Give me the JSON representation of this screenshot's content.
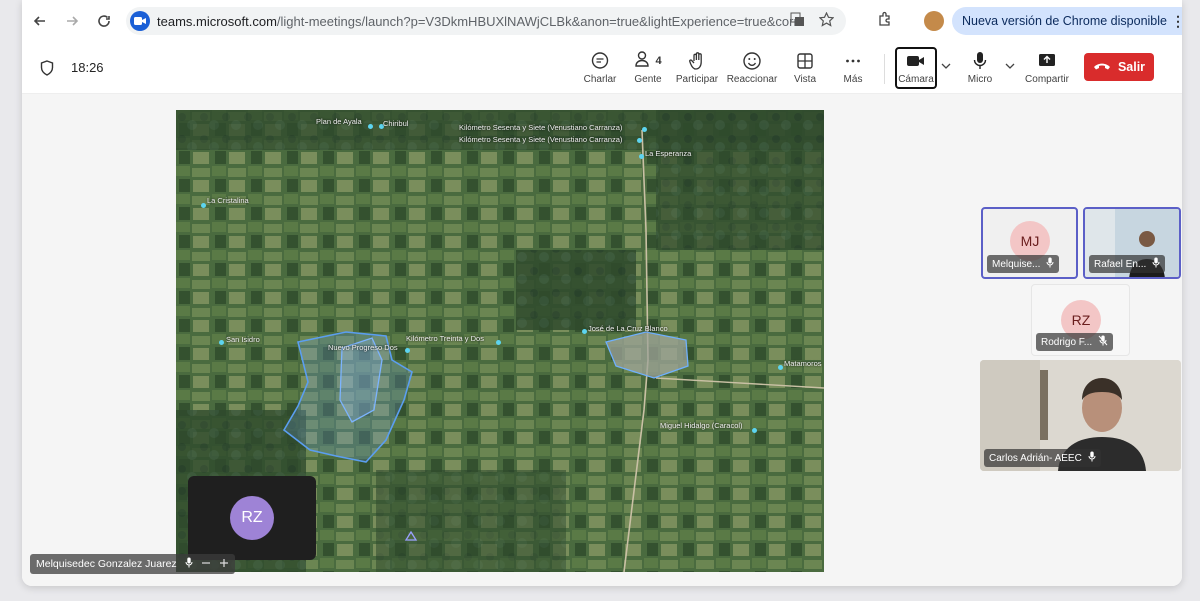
{
  "browser": {
    "url_host": "teams.microsoft.com",
    "url_rest": "/light-meetings/launch?p=V3DkmHBUXlNAWjCLBk&anon=true&lightExperience=true&corre...",
    "update_label": "Nueva versión de Chrome disponible"
  },
  "toolbar": {
    "time": "18:26",
    "chat_label": "Charlar",
    "people_label": "Gente",
    "people_count": "4",
    "raise_label": "Participar",
    "react_label": "Reaccionar",
    "view_label": "Vista",
    "more_label": "Más",
    "camera_label": "Cámara",
    "mic_label": "Micro",
    "share_label": "Compartir",
    "leave_label": "Salir"
  },
  "map": {
    "labels": {
      "plan_de_ayala": "Plan de Ayala",
      "chiribul": "Chiribul",
      "km67a": "Kilómetro Sesenta y Siete (Venustiano Carranza)",
      "km67b": "Kilómetro Sesenta y Siete (Venustiano Carranza)",
      "la_esperanza": "La Esperanza",
      "la_cristalina": "La Cristalina",
      "san_isidro": "San Isidro",
      "nuevo_progreso": "Nuevo Progreso Dos",
      "km32": "Kilómetro Treinta y Dos",
      "jose_cruz": "José de La Cruz Blanco",
      "matamoros": "Matamoros",
      "miguel_hidalgo": "Miguel Hidalgo (Caracol)"
    }
  },
  "self_tile": {
    "initials": "RZ",
    "name": "Melquisedec Gonzalez Juarez"
  },
  "participants": [
    {
      "initials": "MJ",
      "name": "Melquise..."
    },
    {
      "initials": "",
      "name": "Rafael En..."
    },
    {
      "initials": "RZ",
      "name": "Rodrigo F..."
    },
    {
      "initials": "",
      "name": "Carlos Adrián- AEEC"
    }
  ],
  "colors": {
    "leave": "#d92c2c",
    "accent": "#5b5fc7",
    "update_pill": "#d3e3fd"
  }
}
